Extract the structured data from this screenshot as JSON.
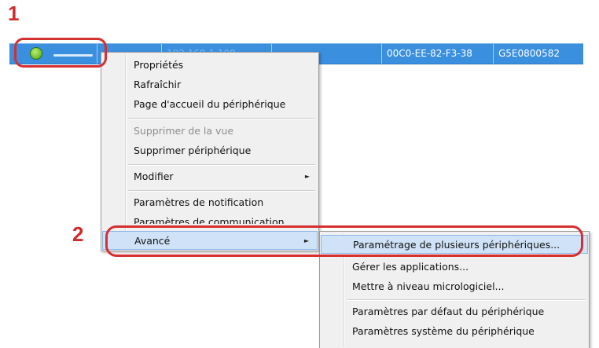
{
  "annotations": {
    "step1": "1",
    "step2": "2"
  },
  "device_row": {
    "ip": "192.168.1.100",
    "mac": "00C0-EE-82-F3-38",
    "serial": "G5E0800582",
    "status_icon": "green-circle-icon"
  },
  "context_menu": {
    "items": [
      {
        "label": "Propriétés"
      },
      {
        "label": "Rafraîchir"
      },
      {
        "label": "Page d'accueil du périphérique"
      },
      {
        "label": "Supprimer de la vue"
      },
      {
        "label": "Supprimer périphérique"
      },
      {
        "label": "Modifier",
        "arrow": "►"
      },
      {
        "label": "Paramètres de notification"
      },
      {
        "label": "Paramètres de communication"
      },
      {
        "label": "Avancé",
        "arrow": "►"
      }
    ]
  },
  "submenu": {
    "items": [
      {
        "label": "Paramétrage de plusieurs périphériques..."
      },
      {
        "label": "Gérer les applications..."
      },
      {
        "label": "Mettre à niveau micrologiciel..."
      },
      {
        "label": "Paramètres par défaut du périphérique"
      },
      {
        "label": "Paramètres système du périphérique"
      }
    ]
  },
  "colors": {
    "selection": "#3a8fdf",
    "highlight_ring": "#d62f2f",
    "menu_bg": "#f0f0f0",
    "menu_active": "#cfe2f7"
  }
}
